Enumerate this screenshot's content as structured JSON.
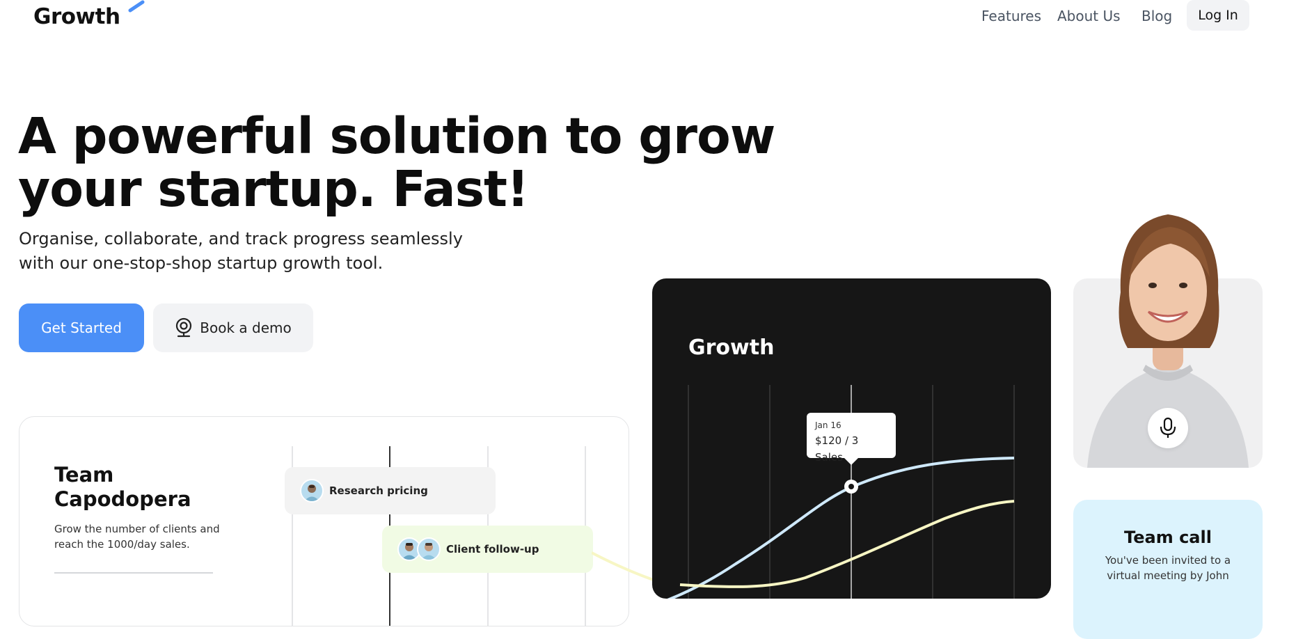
{
  "brand": {
    "name": "Growth",
    "accent": "#4b8ff7"
  },
  "nav": {
    "items": [
      "Features",
      "About Us",
      "Blog"
    ],
    "login_label": "Log In"
  },
  "hero": {
    "headline_line1": "A powerful solution to grow",
    "headline_line2": "your startup. Fast!",
    "subtitle_line1": "Organise, collaborate, and track progress seamlessly",
    "subtitle_line2": "with our one-stop-shop startup growth tool.",
    "primary_button": "Get Started",
    "secondary_button": "Book a demo",
    "secondary_icon": "webcam-icon"
  },
  "team_card": {
    "title": "Team Capodopera",
    "description": "Grow the number of clients and reach the 1000/day sales.",
    "tasks": [
      {
        "label": "Research pricing",
        "color": "#f3f3f3"
      },
      {
        "label": "Client follow-up",
        "color": "#f1fbe4"
      }
    ]
  },
  "growth_card": {
    "title": "Growth",
    "tooltip_date": "Jan 16",
    "tooltip_value": "$120 / 3 Sales",
    "colors": {
      "background": "#161616",
      "line_blue": "#cfe9fb",
      "line_yellow": "#f7f6c4"
    }
  },
  "media_card": {
    "icon": "microphone-icon"
  },
  "call_card": {
    "title": "Team call",
    "text": "You've been invited to a virtual meeting by John"
  }
}
